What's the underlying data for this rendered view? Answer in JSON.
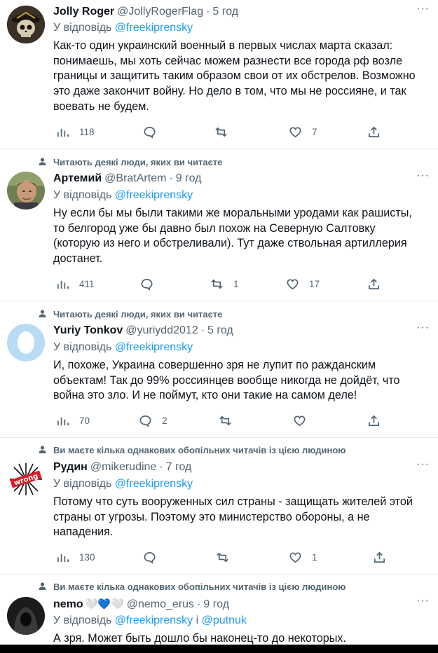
{
  "replying_label": "У відповідь",
  "tweets": [
    {
      "name": "Jolly Roger",
      "handle": "@JollyRogerFlag",
      "time": "5 год",
      "reply_to": [
        "@freekiprensky"
      ],
      "text": "Как-то один украинский военный в первых числах марта сказал:\nпонимаешь, мы хоть сейчас можем разнести все города рф возле\nграницы и защитить таким образом свои от их обстрелов. Возможно\nэто даже закончит войну. Но дело в том, что мы не россияне, и так\nвоевать не будем.",
      "views": "118",
      "replies": "",
      "retweets": "",
      "likes": "7"
    },
    {
      "social": "Читають деякі люди, яких ви читаєте",
      "name": "Артемий",
      "handle": "@BratArtem",
      "time": "9 год",
      "reply_to": [
        "@freekiprensky"
      ],
      "text": "Ну если бы мы были такими же моральными уродами  как рашисты,\nто белгород уже бы давно был похож на Северную Салтовку\n(которую из него и обстреливали). Тут даже ствольная артиллерия\nдостанет.",
      "views": "411",
      "replies": "",
      "retweets": "1",
      "likes": "17"
    },
    {
      "social": "Читають деякі люди, яких ви читаєте",
      "name": "Yuriy Tonkov",
      "handle": "@yuriydd2012",
      "time": "5 год",
      "reply_to": [
        "@freekiprensky"
      ],
      "text": "И, похоже, Украина совершенно зря не лупит по ражданским\nобъектам! Так до 99% россиянцев вообще никогда не дойдёт, что\nвойна это зло. И не поймут, кто они такие на самом деле!",
      "views": "70",
      "replies": "2",
      "retweets": "",
      "likes": ""
    },
    {
      "social": "Ви маєте кілька однакових обопільних читачів із цією людиною",
      "name": "Рудин",
      "handle": "@mikerudine",
      "time": "7 год",
      "reply_to": [
        "@freekiprensky"
      ],
      "avatar_text": "wrong",
      "text": "Потому что суть вооруженных сил страны - защищать жителей этой\nстраны от угрозы. Поэтому это министерство обороны, а не\nнападения.",
      "views": "130",
      "replies": "",
      "retweets": "",
      "likes": "1"
    },
    {
      "social": "Ви маєте кілька однакових обопільних читачів із цією людиною",
      "name": "nemo",
      "name_emoji": [
        "🤍",
        "💙",
        "🤍"
      ],
      "handle": "@nemo_erus",
      "time": "9 год",
      "reply_to": [
        "@freekiprensky",
        "@putnuk"
      ],
      "reply_joiner": "і",
      "text": "А зря. Может быть дошло бы наконец-то до некоторых."
    }
  ],
  "colors": {
    "link": "#1d9bf0",
    "muted": "#536471",
    "text": "#0f1419"
  }
}
